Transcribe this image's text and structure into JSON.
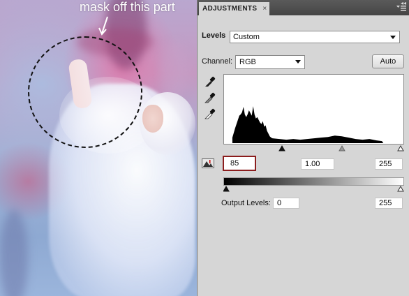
{
  "annotation": {
    "text": "mask off this part"
  },
  "panel": {
    "tab_title": "ADJUSTMENTS",
    "tab_close": "×",
    "menu_icon": "panel-menu-icon",
    "levels_label": "Levels",
    "preset": "Custom",
    "channel_label": "Channel:",
    "channel": "RGB",
    "auto_label": "Auto",
    "input_levels": {
      "black": "85",
      "gamma": "1.00",
      "white": "255"
    },
    "output_label": "Output Levels:",
    "output_levels": {
      "black": "0",
      "white": "255"
    },
    "input_slider_levels": {
      "black": 85,
      "gamma": 1.0,
      "white": 255
    },
    "output_slider_levels": {
      "black": 0,
      "white": 255
    }
  },
  "icons": {
    "eyedropper_black": "black-point-eyedropper-icon",
    "eyedropper_gray": "gray-point-eyedropper-icon",
    "eyedropper_white": "white-point-eyedropper-icon",
    "clipping": "clipping-warning-icon"
  },
  "colors": {
    "panel_bg": "#d6d6d6",
    "titlebar": "#4d4d4d",
    "highlight_border": "#8b1d1d"
  }
}
